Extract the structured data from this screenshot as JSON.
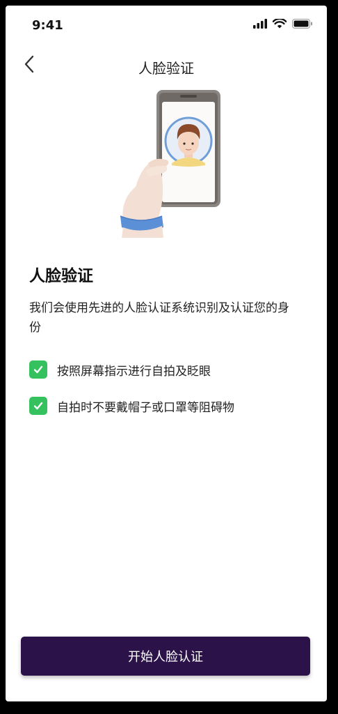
{
  "status_bar": {
    "time": "9:41",
    "icons": [
      "signal-icon",
      "wifi-icon",
      "battery-icon"
    ]
  },
  "nav": {
    "back_icon": "chevron-left-icon",
    "title": "人脸验证"
  },
  "illustration": {
    "icon": "face-verification-illustration"
  },
  "content": {
    "title": "人脸验证",
    "description": "我们会使用先进的人脸认证系统识别及认证您的身份",
    "tips": [
      {
        "icon": "check-icon",
        "text": "按照屏幕指示进行自拍及眨眼"
      },
      {
        "icon": "check-icon",
        "text": "自拍时不要戴帽子或口罩等阻碍物"
      }
    ]
  },
  "actions": {
    "start_label": "开始人脸认证"
  },
  "colors": {
    "primary_button": "#2b1248",
    "check_green": "#35c25e",
    "wristband_blue": "#5b8fd6"
  }
}
